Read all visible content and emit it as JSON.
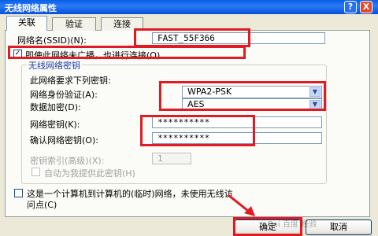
{
  "window": {
    "title": "无线网络属性",
    "help_label": "?",
    "close_label": "X"
  },
  "tabs": [
    {
      "label": "关联",
      "active": true
    },
    {
      "label": "验证",
      "active": false
    },
    {
      "label": "连接",
      "active": false
    }
  ],
  "ssid": {
    "label": "网络名(SSID)(N):",
    "value": "FAST_55F366"
  },
  "broadcast": {
    "label": "即使此网络未广播，也进行连接(O)",
    "checked": true
  },
  "key_group": {
    "title": "无线网络密钥",
    "desc": "此网络要求下列密钥:",
    "auth_label": "网络身份验证(A):",
    "auth_value": "WPA2-PSK",
    "enc_label": "数据加密(D):",
    "enc_value": "AES",
    "key_label": "网络密钥(K):",
    "key_value": "**********",
    "confirm_label": "确认网络密钥(O):",
    "confirm_value": "**********",
    "index_label": "密钥索引(高级)(X):",
    "index_value": "1",
    "auto_label": "自动为我提供此密钥(H)",
    "auto_checked": false
  },
  "adhoc": {
    "label_line1": "这是一个计算机到计算机的(临时)网络，未使用无线访",
    "label_line2": "问点(C)",
    "checked": false
  },
  "buttons": {
    "ok": "确定",
    "cancel": "取消"
  },
  "watermark": "Bai 百度 经验",
  "colors": {
    "title_bar": "#0a5ce6",
    "highlight": "#e01b24",
    "dialog_bg": "#ece9d8"
  }
}
